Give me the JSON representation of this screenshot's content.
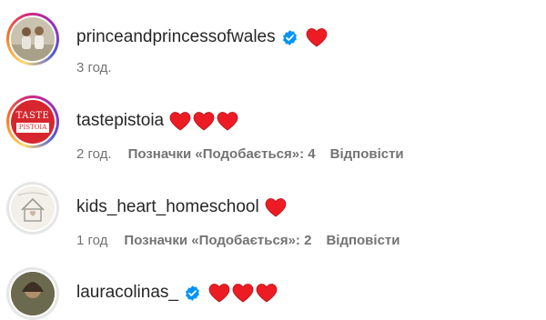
{
  "comments": [
    {
      "username": "princeandprincessofwales",
      "verified": true,
      "text": "❤",
      "time": "3 год.",
      "likes_label": "",
      "reply_label": ""
    },
    {
      "username": "tastepistoia",
      "verified": false,
      "text": "❤❤❤",
      "time": "2 год.",
      "likes_label": "Позначки «Подобається»: 4",
      "reply_label": "Відповісти",
      "avatar_text_top": "TASTE",
      "avatar_text_bottom": "PISTOIA"
    },
    {
      "username": "kids_heart_homeschool",
      "verified": false,
      "text": "❤",
      "time": "1 год",
      "likes_label": "Позначки «Подобається»: 2",
      "reply_label": "Відповісти"
    },
    {
      "username": "lauracolinas_",
      "verified": true,
      "text": "❤❤❤",
      "time": "",
      "likes_label": "",
      "reply_label": ""
    }
  ],
  "colors": {
    "heart": "#ed1c24",
    "verified": "#0095f6",
    "meta_text": "#737373",
    "username_text": "#262626"
  }
}
